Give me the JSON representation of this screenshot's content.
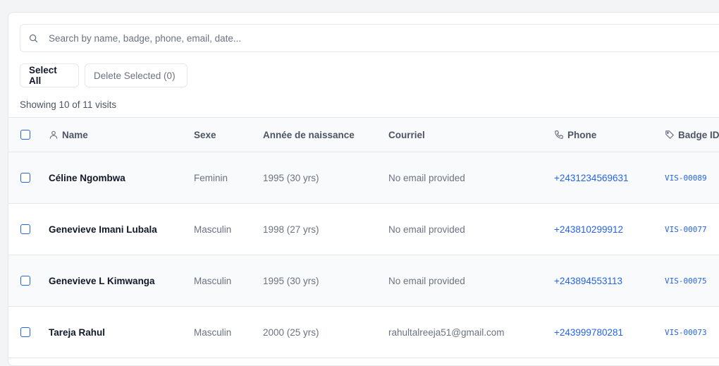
{
  "search": {
    "placeholder": "Search by name, badge, phone, email, date..."
  },
  "actions": {
    "select_all": "Select All",
    "delete_selected": "Delete Selected (0)"
  },
  "summary": "Showing 10 of 11 visits",
  "columns": {
    "name": "Name",
    "sexe": "Sexe",
    "annee": "Année de naissance",
    "courriel": "Courriel",
    "phone": "Phone",
    "badge": "Badge ID"
  },
  "rows": [
    {
      "name": "Céline Ngombwa",
      "sexe": "Feminin",
      "annee": "1995 (30 yrs)",
      "courriel": "No email provided",
      "phone": "+2431234569631",
      "badge": "VIS-00089"
    },
    {
      "name": "Genevieve Imani Lubala",
      "sexe": "Masculin",
      "annee": "1998 (27 yrs)",
      "courriel": "No email provided",
      "phone": "+243810299912",
      "badge": "VIS-00077"
    },
    {
      "name": "Genevieve L Kimwanga",
      "sexe": "Masculin",
      "annee": "1995 (30 yrs)",
      "courriel": "No email provided",
      "phone": "+243894553113",
      "badge": "VIS-00075"
    },
    {
      "name": "Tareja Rahul",
      "sexe": "Masculin",
      "annee": "2000 (25 yrs)",
      "courriel": "rahultalreeja51@gmail.com",
      "phone": "+243999780281",
      "badge": "VIS-00073"
    }
  ],
  "icons": {
    "search": "search-icon",
    "name": "user-icon",
    "phone": "phone-icon",
    "badge": "tag-icon"
  },
  "colors": {
    "accent": "#2563eb",
    "border": "#e5e7eb",
    "background": "#f3f4f6"
  }
}
